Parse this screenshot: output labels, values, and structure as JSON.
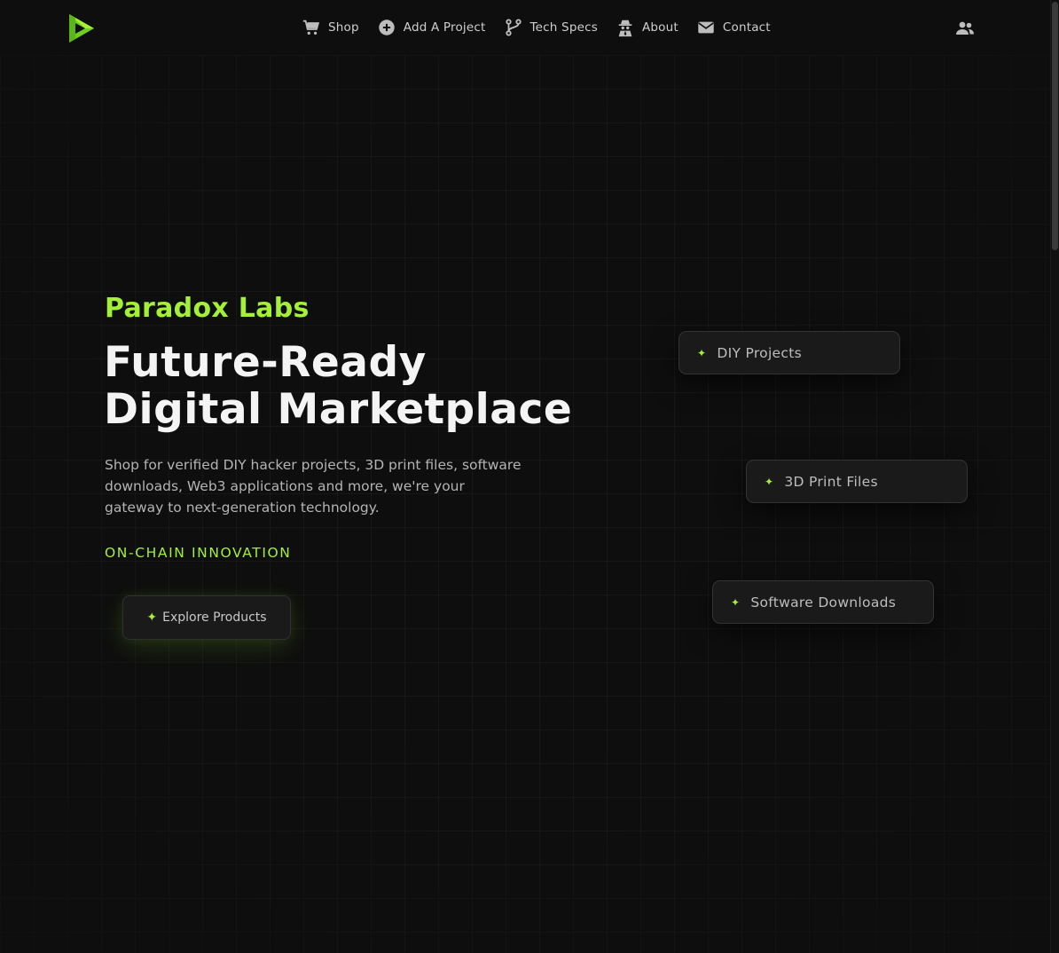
{
  "header": {
    "logo_icon": "paradox-logo-icon",
    "nav": [
      {
        "label": "Shop",
        "icon": "cart-icon"
      },
      {
        "label": "Add A Project",
        "icon": "plus-circle-icon"
      },
      {
        "label": "Tech Specs",
        "icon": "git-branch-icon"
      },
      {
        "label": "About",
        "icon": "spy-icon"
      },
      {
        "label": "Contact",
        "icon": "envelope-icon"
      }
    ],
    "user_icon": "users-icon"
  },
  "hero": {
    "brand": "Paradox Labs",
    "headline_line1": "Future-Ready",
    "headline_line2": "Digital Marketplace",
    "description": "Shop for verified DIY hacker projects, 3D print files, software downloads, Web3 applications and more, we're your gateway to next-generation technology.",
    "tagline": "ON-CHAIN INNOVATION",
    "cta_label": "Explore Products"
  },
  "chips": [
    {
      "label": "DIY Projects"
    },
    {
      "label": "3D Print Files"
    },
    {
      "label": "Software Downloads"
    }
  ],
  "colors": {
    "accent": "#a3f037",
    "background": "#0e0e0e",
    "card": "#1a1a1a"
  }
}
